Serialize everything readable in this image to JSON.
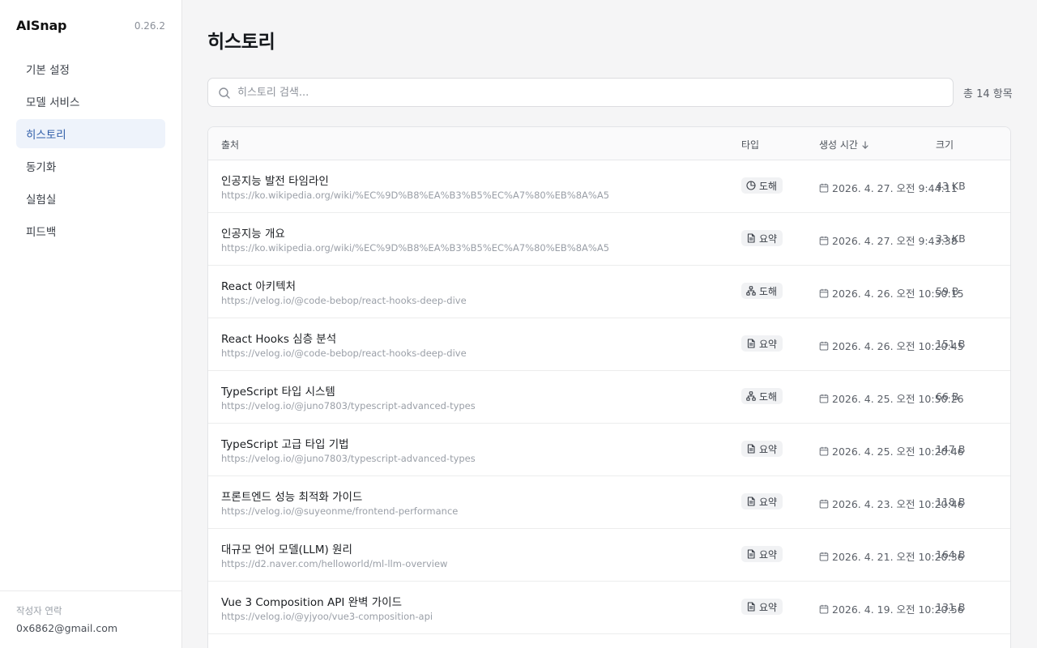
{
  "app": {
    "name": "AISnap",
    "version": "0.26.2"
  },
  "sidebar": {
    "items": [
      {
        "label": "기본 설정",
        "active": false
      },
      {
        "label": "모델 서비스",
        "active": false
      },
      {
        "label": "히스토리",
        "active": true
      },
      {
        "label": "동기화",
        "active": false
      },
      {
        "label": "실험실",
        "active": false
      },
      {
        "label": "피드백",
        "active": false
      }
    ],
    "footer": {
      "label": "작성자 연락",
      "email": "0x6862@gmail.com"
    }
  },
  "page": {
    "title": "히스토리"
  },
  "search": {
    "placeholder": "히스토리 검색...",
    "value": ""
  },
  "total": "총 14 항목",
  "table": {
    "headers": {
      "source": "출처",
      "type": "타입",
      "time": "생성 시간",
      "size": "크기"
    },
    "rows": [
      {
        "title": "인공지능 발전 타임라인",
        "url": "https://ko.wikipedia.org/wiki/%EC%9D%B8%EA%B3%B5%EC%A7%80%EB%8A%A5",
        "type": "도해",
        "type_icon": "pie-chart-icon",
        "time": "2026. 4. 27. 오전 9:44:11",
        "size": "43 KB"
      },
      {
        "title": "인공지능 개요",
        "url": "https://ko.wikipedia.org/wiki/%EC%9D%B8%EA%B3%B5%EC%A7%80%EB%8A%A5",
        "type": "요약",
        "type_icon": "document-icon",
        "time": "2026. 4. 27. 오전 9:43:38",
        "size": "33 KB"
      },
      {
        "title": "React 아키텍처",
        "url": "https://velog.io/@code-bebop/react-hooks-deep-dive",
        "type": "도해",
        "type_icon": "hierarchy-icon",
        "time": "2026. 4. 26. 오전 10:50:15",
        "size": "59 B"
      },
      {
        "title": "React Hooks 심층 분석",
        "url": "https://velog.io/@code-bebop/react-hooks-deep-dive",
        "type": "요약",
        "type_icon": "document-icon",
        "time": "2026. 4. 26. 오전 10:20:45",
        "size": "151 B"
      },
      {
        "title": "TypeScript 타입 시스템",
        "url": "https://velog.io/@juno7803/typescript-advanced-types",
        "type": "도해",
        "type_icon": "hierarchy-icon",
        "time": "2026. 4. 25. 오전 10:50:26",
        "size": "66 B"
      },
      {
        "title": "TypeScript 고급 타입 기법",
        "url": "https://velog.io/@juno7803/typescript-advanced-types",
        "type": "요약",
        "type_icon": "document-icon",
        "time": "2026. 4. 25. 오전 10:20:46",
        "size": "147 B"
      },
      {
        "title": "프론트엔드 성능 최적화 가이드",
        "url": "https://velog.io/@suyeonme/frontend-performance",
        "type": "요약",
        "type_icon": "document-icon",
        "time": "2026. 4. 23. 오전 10:20:46",
        "size": "118 B"
      },
      {
        "title": "대규모 언어 모델(LLM) 원리",
        "url": "https://d2.naver.com/helloworld/ml-llm-overview",
        "type": "요약",
        "type_icon": "document-icon",
        "time": "2026. 4. 21. 오전 10:20:36",
        "size": "164 B"
      },
      {
        "title": "Vue 3 Composition API 완벽 가이드",
        "url": "https://velog.io/@yjyoo/vue3-composition-api",
        "type": "요약",
        "type_icon": "document-icon",
        "time": "2026. 4. 19. 오전 10:20:56",
        "size": "131 B"
      }
    ]
  }
}
